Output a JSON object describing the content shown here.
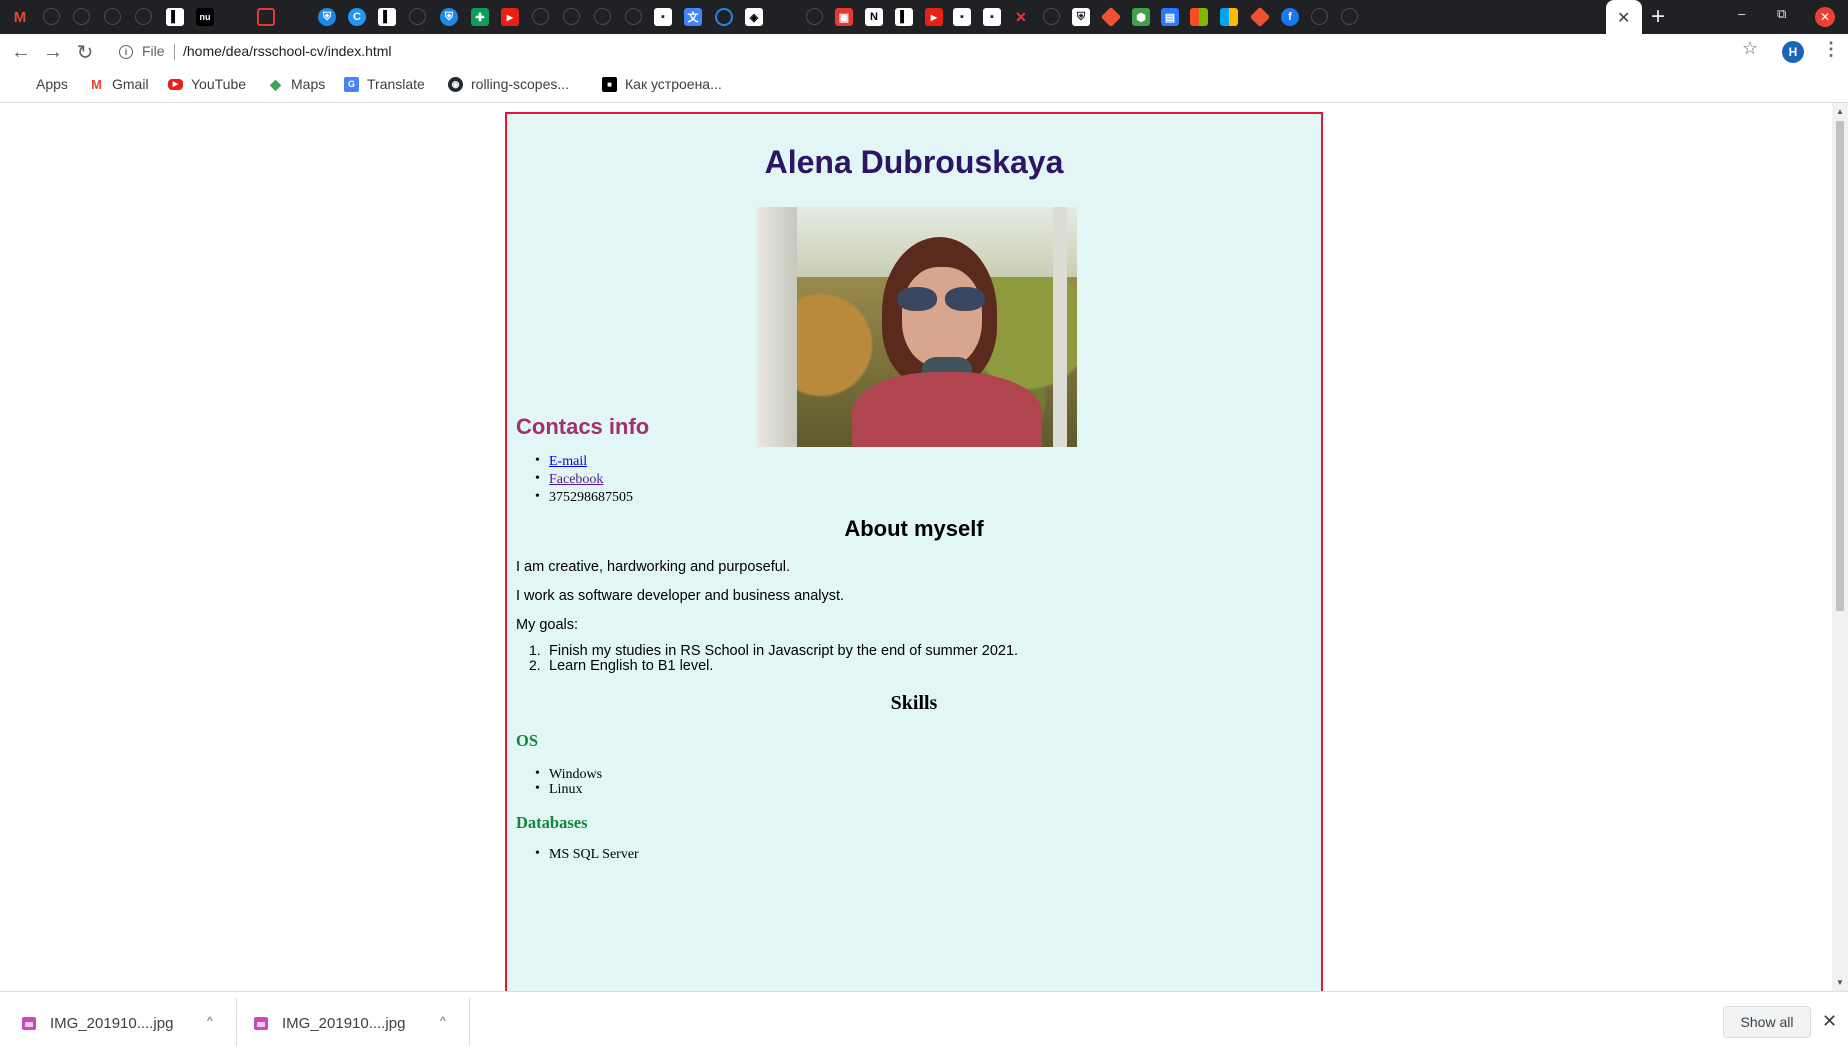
{
  "browser": {
    "tabs_icons": [
      "gmail-icon",
      "site-icon",
      "site-icon",
      "site-icon",
      "site-icon",
      "notion-icon",
      "nu-icon",
      "site-icon",
      "red-box-icon",
      "site-icon",
      "shield-icon",
      "c-icon",
      "notion-icon",
      "site-icon",
      "shield-icon",
      "sheets-icon",
      "youtube-icon",
      "site-icon",
      "site-icon",
      "site-icon",
      "site-icon",
      "chat-icon",
      "translate-icon",
      "cloud-icon",
      "codepen-icon",
      "site-icon",
      "site-icon",
      "screen-icon",
      "notion-icon",
      "notion-icon",
      "youtube-icon",
      "chat-icon",
      "chat-icon",
      "close-red-icon",
      "site-icon",
      "shield-icon",
      "git-icon",
      "node-icon",
      "image-icon",
      "microsoft-icon",
      "microsoft-icon",
      "git-icon",
      "facebook-icon",
      "site-icon",
      "site-icon"
    ],
    "nu_label": "nu",
    "active_tab_close": "✕",
    "new_tab": "+",
    "window_min": "–",
    "window_restore": "⧉",
    "window_close": "✕",
    "url_scheme": "File",
    "url_path": "/home/dea/rsschool-cv/index.html",
    "profile_initial": "H",
    "bookmarks": [
      {
        "label": "Apps",
        "icon": "apps-grid-icon"
      },
      {
        "label": "Gmail",
        "icon": "gmail-icon"
      },
      {
        "label": "YouTube",
        "icon": "youtube-icon"
      },
      {
        "label": "Maps",
        "icon": "maps-icon"
      },
      {
        "label": "Translate",
        "icon": "translate-icon"
      },
      {
        "label": "rolling-scopes...",
        "icon": "github-icon"
      },
      {
        "label": "Как устроена...",
        "icon": "video-icon"
      }
    ]
  },
  "cv": {
    "name": "Alena Dubrouskaya",
    "contacts_heading": "Contacs info",
    "contacts": {
      "email": "E-mail",
      "facebook": "Facebook",
      "phone": "375298687505"
    },
    "about_heading": "About myself",
    "about_p1": "I am creative, hardworking and purposeful.",
    "about_p2": "I work as software developer and business analyst.",
    "goals_label": "My goals:",
    "goals": [
      "Finish my studies in RS School in Javascript by the end of summer 2021.",
      "Learn English to B1 level."
    ],
    "skills_heading": "Skills",
    "os_heading": "OS",
    "os": [
      "Windows",
      "Linux"
    ],
    "db_heading": "Databases",
    "db": [
      "MS SQL Server"
    ]
  },
  "downloads": {
    "items": [
      "IMG_201910....jpg",
      "IMG_201910....jpg"
    ],
    "show_all": "Show all",
    "close": "✕"
  },
  "colors": {
    "tabstrip": "#202124",
    "cv_border": "#e3163a",
    "cv_background": "#e3f6f6",
    "name_color": "#2c1565",
    "contacts_heading_color": "#a1306d",
    "skill_subheading_color": "#12863a"
  }
}
